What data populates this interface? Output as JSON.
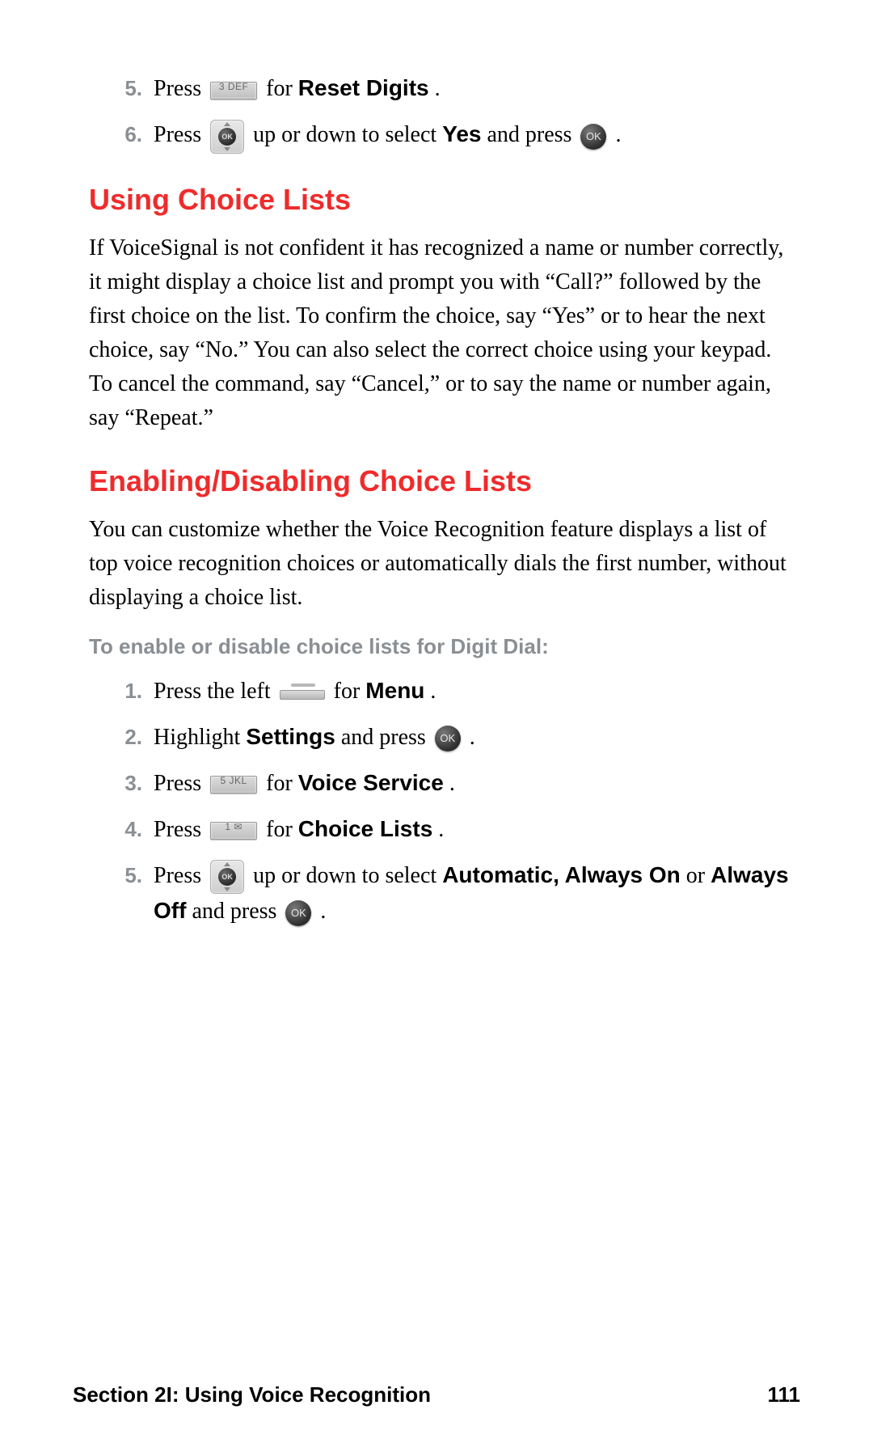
{
  "steps_top": [
    {
      "n": "5.",
      "pre": "Press ",
      "key_type": "num",
      "key_label": "3 DEF",
      "mid": " for ",
      "bold1": "Reset Digits",
      "post": "."
    },
    {
      "n": "6.",
      "pre": "Press ",
      "key_type": "nav",
      "mid": " up or down to select ",
      "bold1": "Yes",
      "mid2": " and press ",
      "key2_type": "ok",
      "post": "."
    }
  ],
  "heading1": "Using Choice Lists",
  "para1": "If VoiceSignal is not confident it has recognized a name or number correctly, it might display a choice list and prompt you with “Call?” followed by the first choice on the list. To confirm the choice, say “Yes” or to hear the next choice, say “No.” You can also select the correct choice using your keypad. To cancel the command, say “Cancel,” or to say the name or number again, say “Repeat.”",
  "heading2": "Enabling/Disabling Choice Lists",
  "para2": "You can customize whether the Voice Recognition feature displays a list of top voice recognition choices or automatically dials the first number, without displaying a choice list.",
  "sub1": "To enable or disable choice lists for Digit Dial:",
  "steps_bottom": [
    {
      "n": "1.",
      "pre": "Press the left ",
      "key_type": "left",
      "mid": " for ",
      "bold1": "Menu",
      "post": "."
    },
    {
      "n": "2.",
      "pre": "Highlight ",
      "bold_pre": "Settings",
      "mid_plain": " and press ",
      "key_type_after": "ok",
      "post": "."
    },
    {
      "n": "3.",
      "pre": "Press ",
      "key_type": "num",
      "key_label": "5 JKL",
      "mid": " for ",
      "bold1": "Voice Service",
      "post": "."
    },
    {
      "n": "4.",
      "pre": "Press ",
      "key_type": "num",
      "key_label": "1 ✉",
      "mid": " for ",
      "bold1": "Choice Lists",
      "post": "."
    },
    {
      "n": "5.",
      "pre": "Press ",
      "key_type": "nav",
      "mid": " up or down to select ",
      "bold1": "Automatic, Always On",
      "mid2": " or ",
      "bold2": "Always Off",
      "mid3": " and press ",
      "key2_type": "ok",
      "post": "."
    }
  ],
  "footer_left": "Section 2I: Using Voice Recognition",
  "footer_right": "111"
}
